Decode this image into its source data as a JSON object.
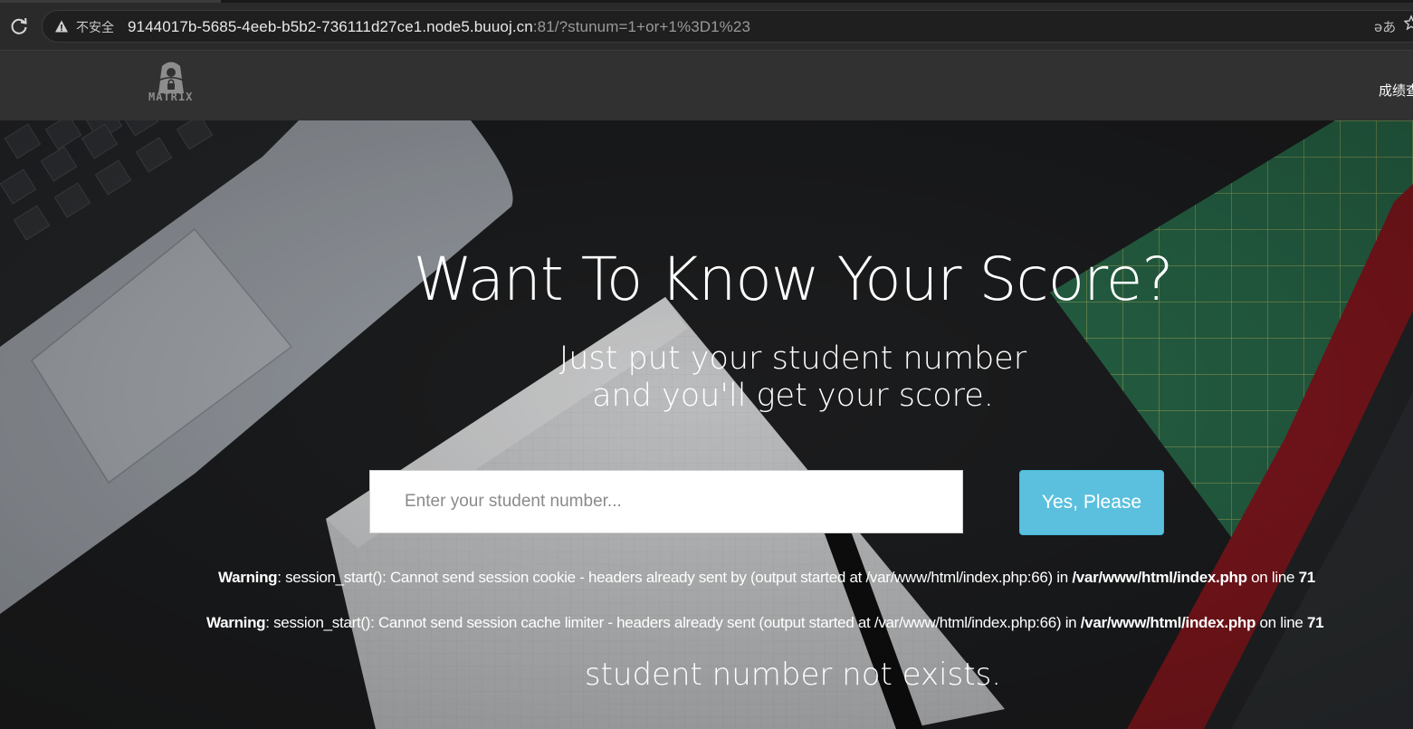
{
  "browser": {
    "security_label": "不安全",
    "url_host": "9144017b-5685-4eeb-b5b2-736111d27ce1.node5.buuoj.cn",
    "url_rest": ":81/?stunum=1+or+1%3D1%23",
    "translate_glyph": "ǝあ"
  },
  "nav": {
    "logo_text": "MATR1X",
    "link_label": "成绩查"
  },
  "hero": {
    "title": "Want To Know Your Score?",
    "subtitle_line1": "Just put your student number",
    "subtitle_line2": "and you'll get your score.",
    "input_placeholder": "Enter your student number...",
    "submit_label": "Yes, Please"
  },
  "warnings": [
    {
      "label": "Warning",
      "message": ": session_start(): Cannot send session cookie - headers already sent by (output started at /var/www/html/index.php:66) in ",
      "file": "/var/www/html/index.php",
      "line_prefix": " on line ",
      "line": "71"
    },
    {
      "label": "Warning",
      "message": ": session_start(): Cannot send session cache limiter - headers already sent (output started at /var/www/html/index.php:66) in ",
      "file": "/var/www/html/index.php",
      "line_prefix": " on line ",
      "line": "71"
    }
  ],
  "result_message": "student number not exists.",
  "colors": {
    "button": "#5bc0de",
    "nav_bg": "#313131",
    "chrome_bg": "#2a2a2b"
  }
}
